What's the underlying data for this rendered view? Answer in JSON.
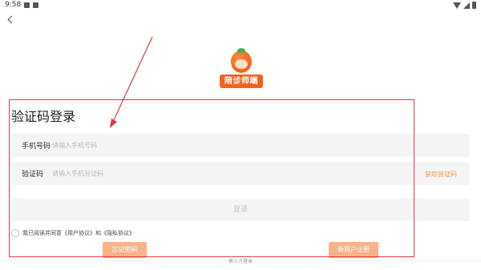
{
  "status_bar": {
    "time": "9:58"
  },
  "logo": {
    "text": "陪诊师端"
  },
  "page": {
    "title": "验证码登录"
  },
  "form": {
    "phone_label": "手机号码",
    "phone_placeholder": "请输入手机号码",
    "code_label": "验证码",
    "code_placeholder": "请输入手机验证码",
    "get_code_label": "获取验证码",
    "login_label": "登录"
  },
  "agreement": {
    "prefix": "我已阅读并同意",
    "user_agreement": "《用户协议》",
    "conjunction": "和",
    "privacy_policy": "《隐私协议》"
  },
  "actions": {
    "forgot_password_label": "忘记密码",
    "register_label": "新用户注册",
    "third_party_label": "第三方登录"
  },
  "colors": {
    "accent": "#f0621f",
    "link_orange": "#f59a4a",
    "button_orange": "#f8b38a",
    "annotation_red": "#e0393e"
  }
}
